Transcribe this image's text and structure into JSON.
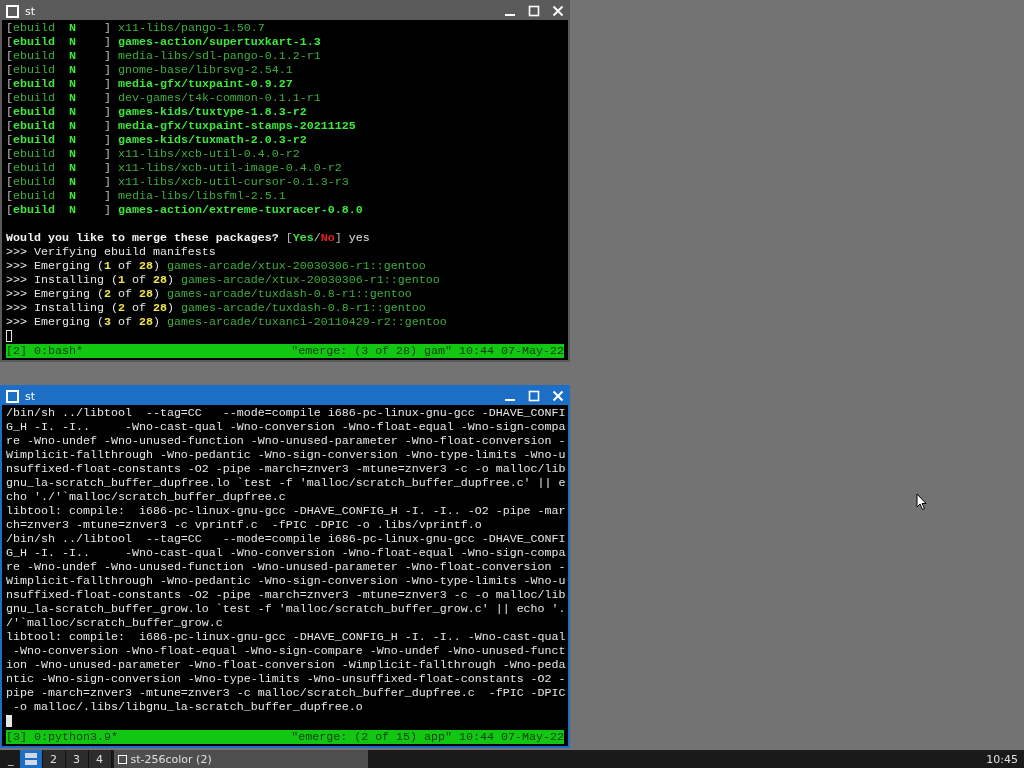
{
  "windows": [
    {
      "title": "st",
      "focused": false,
      "lines": [
        {
          "kind": "text",
          "segs": [
            {
              "text": "[",
              "kind": "grey"
            },
            {
              "text": "ebuild  ",
              "kind": "green"
            },
            {
              "text": "N    ",
              "kind": "bright"
            },
            {
              "text": "] ",
              "kind": "grey"
            },
            {
              "text": "x11-libs/pango-1.50.7",
              "kind": "green"
            }
          ]
        },
        {
          "kind": "text",
          "segs": [
            {
              "text": "[",
              "kind": "grey"
            },
            {
              "text": "ebuild  ",
              "kind": "bright"
            },
            {
              "text": "N    ",
              "kind": "bright"
            },
            {
              "text": "] ",
              "kind": "grey"
            },
            {
              "text": "games-action/supertuxkart-1.3",
              "kind": "bright"
            }
          ]
        },
        {
          "kind": "text",
          "segs": [
            {
              "text": "[",
              "kind": "grey"
            },
            {
              "text": "ebuild  ",
              "kind": "green"
            },
            {
              "text": "N    ",
              "kind": "bright"
            },
            {
              "text": "] ",
              "kind": "grey"
            },
            {
              "text": "media-libs/sdl-pango-0.1.2-r1",
              "kind": "green"
            }
          ]
        },
        {
          "kind": "text",
          "segs": [
            {
              "text": "[",
              "kind": "grey"
            },
            {
              "text": "ebuild  ",
              "kind": "green"
            },
            {
              "text": "N    ",
              "kind": "bright"
            },
            {
              "text": "] ",
              "kind": "grey"
            },
            {
              "text": "gnome-base/librsvg-2.54.1",
              "kind": "green"
            }
          ]
        },
        {
          "kind": "text",
          "segs": [
            {
              "text": "[",
              "kind": "grey"
            },
            {
              "text": "ebuild  ",
              "kind": "bright"
            },
            {
              "text": "N    ",
              "kind": "bright"
            },
            {
              "text": "] ",
              "kind": "grey"
            },
            {
              "text": "media-gfx/tuxpaint-0.9.27",
              "kind": "bright"
            }
          ]
        },
        {
          "kind": "text",
          "segs": [
            {
              "text": "[",
              "kind": "grey"
            },
            {
              "text": "ebuild  ",
              "kind": "green"
            },
            {
              "text": "N    ",
              "kind": "bright"
            },
            {
              "text": "] ",
              "kind": "grey"
            },
            {
              "text": "dev-games/t4k-common-0.1.1-r1",
              "kind": "green"
            }
          ]
        },
        {
          "kind": "text",
          "segs": [
            {
              "text": "[",
              "kind": "grey"
            },
            {
              "text": "ebuild  ",
              "kind": "bright"
            },
            {
              "text": "N    ",
              "kind": "bright"
            },
            {
              "text": "] ",
              "kind": "grey"
            },
            {
              "text": "games-kids/tuxtype-1.8.3-r2",
              "kind": "bright"
            }
          ]
        },
        {
          "kind": "text",
          "segs": [
            {
              "text": "[",
              "kind": "grey"
            },
            {
              "text": "ebuild  ",
              "kind": "bright"
            },
            {
              "text": "N    ",
              "kind": "bright"
            },
            {
              "text": "] ",
              "kind": "grey"
            },
            {
              "text": "media-gfx/tuxpaint-stamps-20211125",
              "kind": "bright"
            }
          ]
        },
        {
          "kind": "text",
          "segs": [
            {
              "text": "[",
              "kind": "grey"
            },
            {
              "text": "ebuild  ",
              "kind": "bright"
            },
            {
              "text": "N    ",
              "kind": "bright"
            },
            {
              "text": "] ",
              "kind": "grey"
            },
            {
              "text": "games-kids/tuxmath-2.0.3-r2",
              "kind": "bright"
            }
          ]
        },
        {
          "kind": "text",
          "segs": [
            {
              "text": "[",
              "kind": "grey"
            },
            {
              "text": "ebuild  ",
              "kind": "green"
            },
            {
              "text": "N    ",
              "kind": "bright"
            },
            {
              "text": "] ",
              "kind": "grey"
            },
            {
              "text": "x11-libs/xcb-util-0.4.0-r2",
              "kind": "green"
            }
          ]
        },
        {
          "kind": "text",
          "segs": [
            {
              "text": "[",
              "kind": "grey"
            },
            {
              "text": "ebuild  ",
              "kind": "green"
            },
            {
              "text": "N    ",
              "kind": "bright"
            },
            {
              "text": "] ",
              "kind": "grey"
            },
            {
              "text": "x11-libs/xcb-util-image-0.4.0-r2",
              "kind": "green"
            }
          ]
        },
        {
          "kind": "text",
          "segs": [
            {
              "text": "[",
              "kind": "grey"
            },
            {
              "text": "ebuild  ",
              "kind": "green"
            },
            {
              "text": "N    ",
              "kind": "bright"
            },
            {
              "text": "] ",
              "kind": "grey"
            },
            {
              "text": "x11-libs/xcb-util-cursor-0.1.3-r3",
              "kind": "green"
            }
          ]
        },
        {
          "kind": "text",
          "segs": [
            {
              "text": "[",
              "kind": "grey"
            },
            {
              "text": "ebuild  ",
              "kind": "green"
            },
            {
              "text": "N    ",
              "kind": "bright"
            },
            {
              "text": "] ",
              "kind": "grey"
            },
            {
              "text": "media-libs/libsfml-2.5.1",
              "kind": "green"
            }
          ]
        },
        {
          "kind": "text",
          "segs": [
            {
              "text": "[",
              "kind": "grey"
            },
            {
              "text": "ebuild  ",
              "kind": "bright"
            },
            {
              "text": "N    ",
              "kind": "bright"
            },
            {
              "text": "] ",
              "kind": "grey"
            },
            {
              "text": "games-action/extreme-tuxracer-0.8.0",
              "kind": "bright"
            }
          ]
        },
        {
          "kind": "blank"
        },
        {
          "kind": "text",
          "segs": [
            {
              "text": "Would you like to merge these packages? ",
              "kind": "bold"
            },
            {
              "text": "[",
              "kind": "grey"
            },
            {
              "text": "Yes",
              "kind": "bright"
            },
            {
              "text": "/",
              "kind": "grey"
            },
            {
              "text": "No",
              "kind": "red"
            },
            {
              "text": "]",
              "kind": "grey"
            },
            {
              "text": " yes",
              "kind": "white"
            }
          ]
        },
        {
          "kind": "text",
          "segs": [
            {
              "text": ">>> Verifying ebuild manifests",
              "kind": "white"
            }
          ]
        },
        {
          "kind": "text",
          "segs": [
            {
              "text": ">>> Emerging (",
              "kind": "white"
            },
            {
              "text": "1",
              "kind": "yellow"
            },
            {
              "text": " of ",
              "kind": "white"
            },
            {
              "text": "28",
              "kind": "yellow"
            },
            {
              "text": ") ",
              "kind": "white"
            },
            {
              "text": "games-arcade/xtux-20030306-r1::gentoo",
              "kind": "green"
            }
          ]
        },
        {
          "kind": "text",
          "segs": [
            {
              "text": ">>> Installing (",
              "kind": "white"
            },
            {
              "text": "1",
              "kind": "yellow"
            },
            {
              "text": " of ",
              "kind": "white"
            },
            {
              "text": "28",
              "kind": "yellow"
            },
            {
              "text": ") ",
              "kind": "white"
            },
            {
              "text": "games-arcade/xtux-20030306-r1::gentoo",
              "kind": "green"
            }
          ]
        },
        {
          "kind": "text",
          "segs": [
            {
              "text": ">>> Emerging (",
              "kind": "white"
            },
            {
              "text": "2",
              "kind": "yellow"
            },
            {
              "text": " of ",
              "kind": "white"
            },
            {
              "text": "28",
              "kind": "yellow"
            },
            {
              "text": ") ",
              "kind": "white"
            },
            {
              "text": "games-arcade/tuxdash-0.8-r1::gentoo",
              "kind": "green"
            }
          ]
        },
        {
          "kind": "text",
          "segs": [
            {
              "text": ">>> Installing (",
              "kind": "white"
            },
            {
              "text": "2",
              "kind": "yellow"
            },
            {
              "text": " of ",
              "kind": "white"
            },
            {
              "text": "28",
              "kind": "yellow"
            },
            {
              "text": ") ",
              "kind": "white"
            },
            {
              "text": "games-arcade/tuxdash-0.8-r1::gentoo",
              "kind": "green"
            }
          ]
        },
        {
          "kind": "text",
          "segs": [
            {
              "text": ">>> Emerging (",
              "kind": "white"
            },
            {
              "text": "3",
              "kind": "yellow"
            },
            {
              "text": " of ",
              "kind": "white"
            },
            {
              "text": "28",
              "kind": "yellow"
            },
            {
              "text": ") ",
              "kind": "white"
            },
            {
              "text": "games-arcade/tuxanci-20110429-r2::gentoo",
              "kind": "green"
            }
          ]
        },
        {
          "kind": "cursor"
        }
      ],
      "status": {
        "left": "[2] 0:bash*",
        "right": "\"emerge: (3 of 28) gam\" 10:44 07-May-22"
      }
    },
    {
      "title": "st",
      "focused": true,
      "lines": [
        {
          "kind": "text",
          "segs": [
            {
              "text": "/bin/sh ../libtool  --tag=CC   --mode=compile i686-pc-linux-gnu-gcc -DHAVE_CONFI",
              "kind": "white"
            }
          ]
        },
        {
          "kind": "text",
          "segs": [
            {
              "text": "G_H -I. -I..     -Wno-cast-qual -Wno-conversion -Wno-float-equal -Wno-sign-compa",
              "kind": "white"
            }
          ]
        },
        {
          "kind": "text",
          "segs": [
            {
              "text": "re -Wno-undef -Wno-unused-function -Wno-unused-parameter -Wno-float-conversion -",
              "kind": "white"
            }
          ]
        },
        {
          "kind": "text",
          "segs": [
            {
              "text": "Wimplicit-fallthrough -Wno-pedantic -Wno-sign-conversion -Wno-type-limits -Wno-u",
              "kind": "white"
            }
          ]
        },
        {
          "kind": "text",
          "segs": [
            {
              "text": "nsuffixed-float-constants -O2 -pipe -march=znver3 -mtune=znver3 -c -o malloc/lib",
              "kind": "white"
            }
          ]
        },
        {
          "kind": "text",
          "segs": [
            {
              "text": "gnu_la-scratch_buffer_dupfree.lo `test -f 'malloc/scratch_buffer_dupfree.c' || e",
              "kind": "white"
            }
          ]
        },
        {
          "kind": "text",
          "segs": [
            {
              "text": "cho './'`malloc/scratch_buffer_dupfree.c",
              "kind": "white"
            }
          ]
        },
        {
          "kind": "text",
          "segs": [
            {
              "text": "libtool: compile:  i686-pc-linux-gnu-gcc -DHAVE_CONFIG_H -I. -I.. -O2 -pipe -mar",
              "kind": "white"
            }
          ]
        },
        {
          "kind": "text",
          "segs": [
            {
              "text": "ch=znver3 -mtune=znver3 -c vprintf.c  -fPIC -DPIC -o .libs/vprintf.o",
              "kind": "white"
            }
          ]
        },
        {
          "kind": "text",
          "segs": [
            {
              "text": "/bin/sh ../libtool  --tag=CC   --mode=compile i686-pc-linux-gnu-gcc -DHAVE_CONFI",
              "kind": "white"
            }
          ]
        },
        {
          "kind": "text",
          "segs": [
            {
              "text": "G_H -I. -I..     -Wno-cast-qual -Wno-conversion -Wno-float-equal -Wno-sign-compa",
              "kind": "white"
            }
          ]
        },
        {
          "kind": "text",
          "segs": [
            {
              "text": "re -Wno-undef -Wno-unused-function -Wno-unused-parameter -Wno-float-conversion -",
              "kind": "white"
            }
          ]
        },
        {
          "kind": "text",
          "segs": [
            {
              "text": "Wimplicit-fallthrough -Wno-pedantic -Wno-sign-conversion -Wno-type-limits -Wno-u",
              "kind": "white"
            }
          ]
        },
        {
          "kind": "text",
          "segs": [
            {
              "text": "nsuffixed-float-constants -O2 -pipe -march=znver3 -mtune=znver3 -c -o malloc/lib",
              "kind": "white"
            }
          ]
        },
        {
          "kind": "text",
          "segs": [
            {
              "text": "gnu_la-scratch_buffer_grow.lo `test -f 'malloc/scratch_buffer_grow.c' || echo '.",
              "kind": "white"
            }
          ]
        },
        {
          "kind": "text",
          "segs": [
            {
              "text": "/'`malloc/scratch_buffer_grow.c",
              "kind": "white"
            }
          ]
        },
        {
          "kind": "text",
          "segs": [
            {
              "text": "libtool: compile:  i686-pc-linux-gnu-gcc -DHAVE_CONFIG_H -I. -I.. -Wno-cast-qual",
              "kind": "white"
            }
          ]
        },
        {
          "kind": "text",
          "segs": [
            {
              "text": " -Wno-conversion -Wno-float-equal -Wno-sign-compare -Wno-undef -Wno-unused-funct",
              "kind": "white"
            }
          ]
        },
        {
          "kind": "text",
          "segs": [
            {
              "text": "ion -Wno-unused-parameter -Wno-float-conversion -Wimplicit-fallthrough -Wno-peda",
              "kind": "white"
            }
          ]
        },
        {
          "kind": "text",
          "segs": [
            {
              "text": "ntic -Wno-sign-conversion -Wno-type-limits -Wno-unsuffixed-float-constants -O2 -",
              "kind": "white"
            }
          ]
        },
        {
          "kind": "text",
          "segs": [
            {
              "text": "pipe -march=znver3 -mtune=znver3 -c malloc/scratch_buffer_dupfree.c  -fPIC -DPIC",
              "kind": "white"
            }
          ]
        },
        {
          "kind": "text",
          "segs": [
            {
              "text": " -o malloc/.libs/libgnu_la-scratch_buffer_dupfree.o",
              "kind": "white"
            }
          ]
        },
        {
          "kind": "cursor"
        }
      ],
      "status": {
        "left": "[3] 0:python3.9*",
        "right": "\"emerge: (2 of 15) app\" 10:44 07-May-22"
      }
    }
  ],
  "taskbar": {
    "layout": "_",
    "tags": [
      {
        "kind": "icon",
        "selected": true
      },
      {
        "kind": "text",
        "label": "2",
        "selected": false
      },
      {
        "kind": "text",
        "label": "3",
        "selected": false
      },
      {
        "kind": "text",
        "label": "4",
        "selected": false
      }
    ],
    "task": "st-256color (2)",
    "clock": "10:45"
  }
}
